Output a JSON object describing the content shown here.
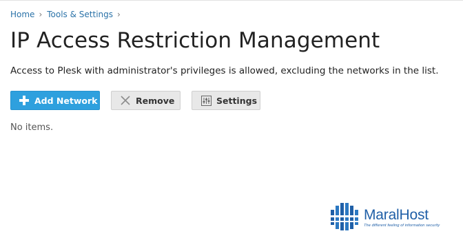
{
  "breadcrumb": {
    "items": [
      "Home",
      "Tools & Settings"
    ],
    "separator": "›"
  },
  "page": {
    "title": "IP Access Restriction Management",
    "description": "Access to Plesk with administrator's privileges is allowed, excluding the networks in the list."
  },
  "toolbar": {
    "add_label": "Add Network",
    "remove_label": "Remove",
    "settings_label": "Settings"
  },
  "list": {
    "empty_text": "No items."
  },
  "watermark": {
    "name": "MaralHost",
    "tagline": "The different feeling of information security"
  },
  "colors": {
    "primary_button": "#2ea0de",
    "link": "#2a72a8",
    "brand": "#1f5fa7"
  },
  "icons": {
    "add": "plus-icon",
    "remove": "x-icon",
    "settings": "sliders-icon"
  }
}
